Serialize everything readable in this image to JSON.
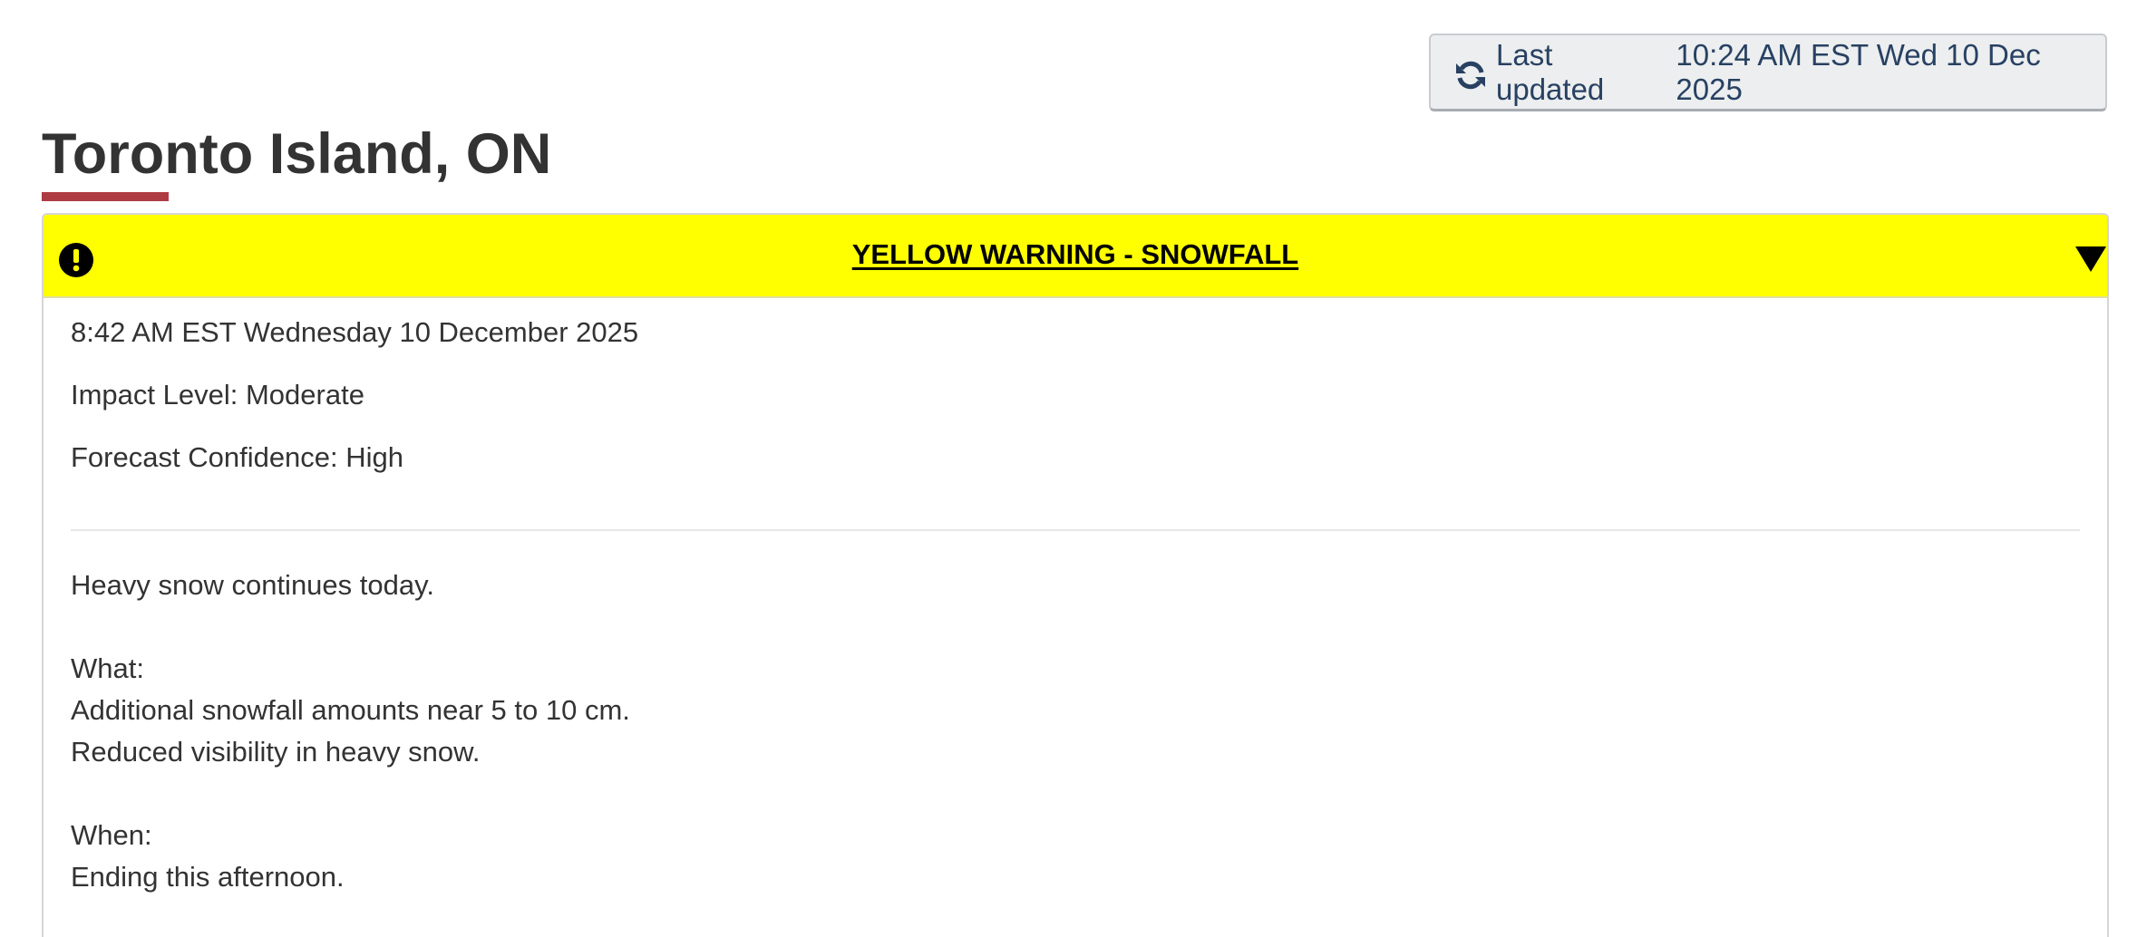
{
  "last_updated": {
    "label": "Last updated",
    "value": "10:24 AM EST Wed 10 Dec 2025",
    "icon": "refresh-icon"
  },
  "location": {
    "title": "Toronto Island, ON"
  },
  "alert": {
    "title": "YELLOW WARNING - SNOWFALL",
    "color": "#ffff00",
    "icon": "exclamation-circle-icon",
    "toggle_icon": "caret-down-icon",
    "issued": "8:42 AM EST Wednesday 10 December 2025",
    "impact_level": "Impact Level: Moderate",
    "forecast_confidence": "Forecast Confidence: High",
    "summary": "Heavy snow continues today.",
    "what_heading": "What:",
    "what_lines": [
      "Additional snowfall amounts near 5 to 10 cm.",
      "Reduced visibility in heavy snow."
    ],
    "when_heading": "When:",
    "when_lines": [
      "Ending this afternoon."
    ]
  },
  "colors": {
    "accent_underline": "#af3c43",
    "button_text": "#284162"
  }
}
